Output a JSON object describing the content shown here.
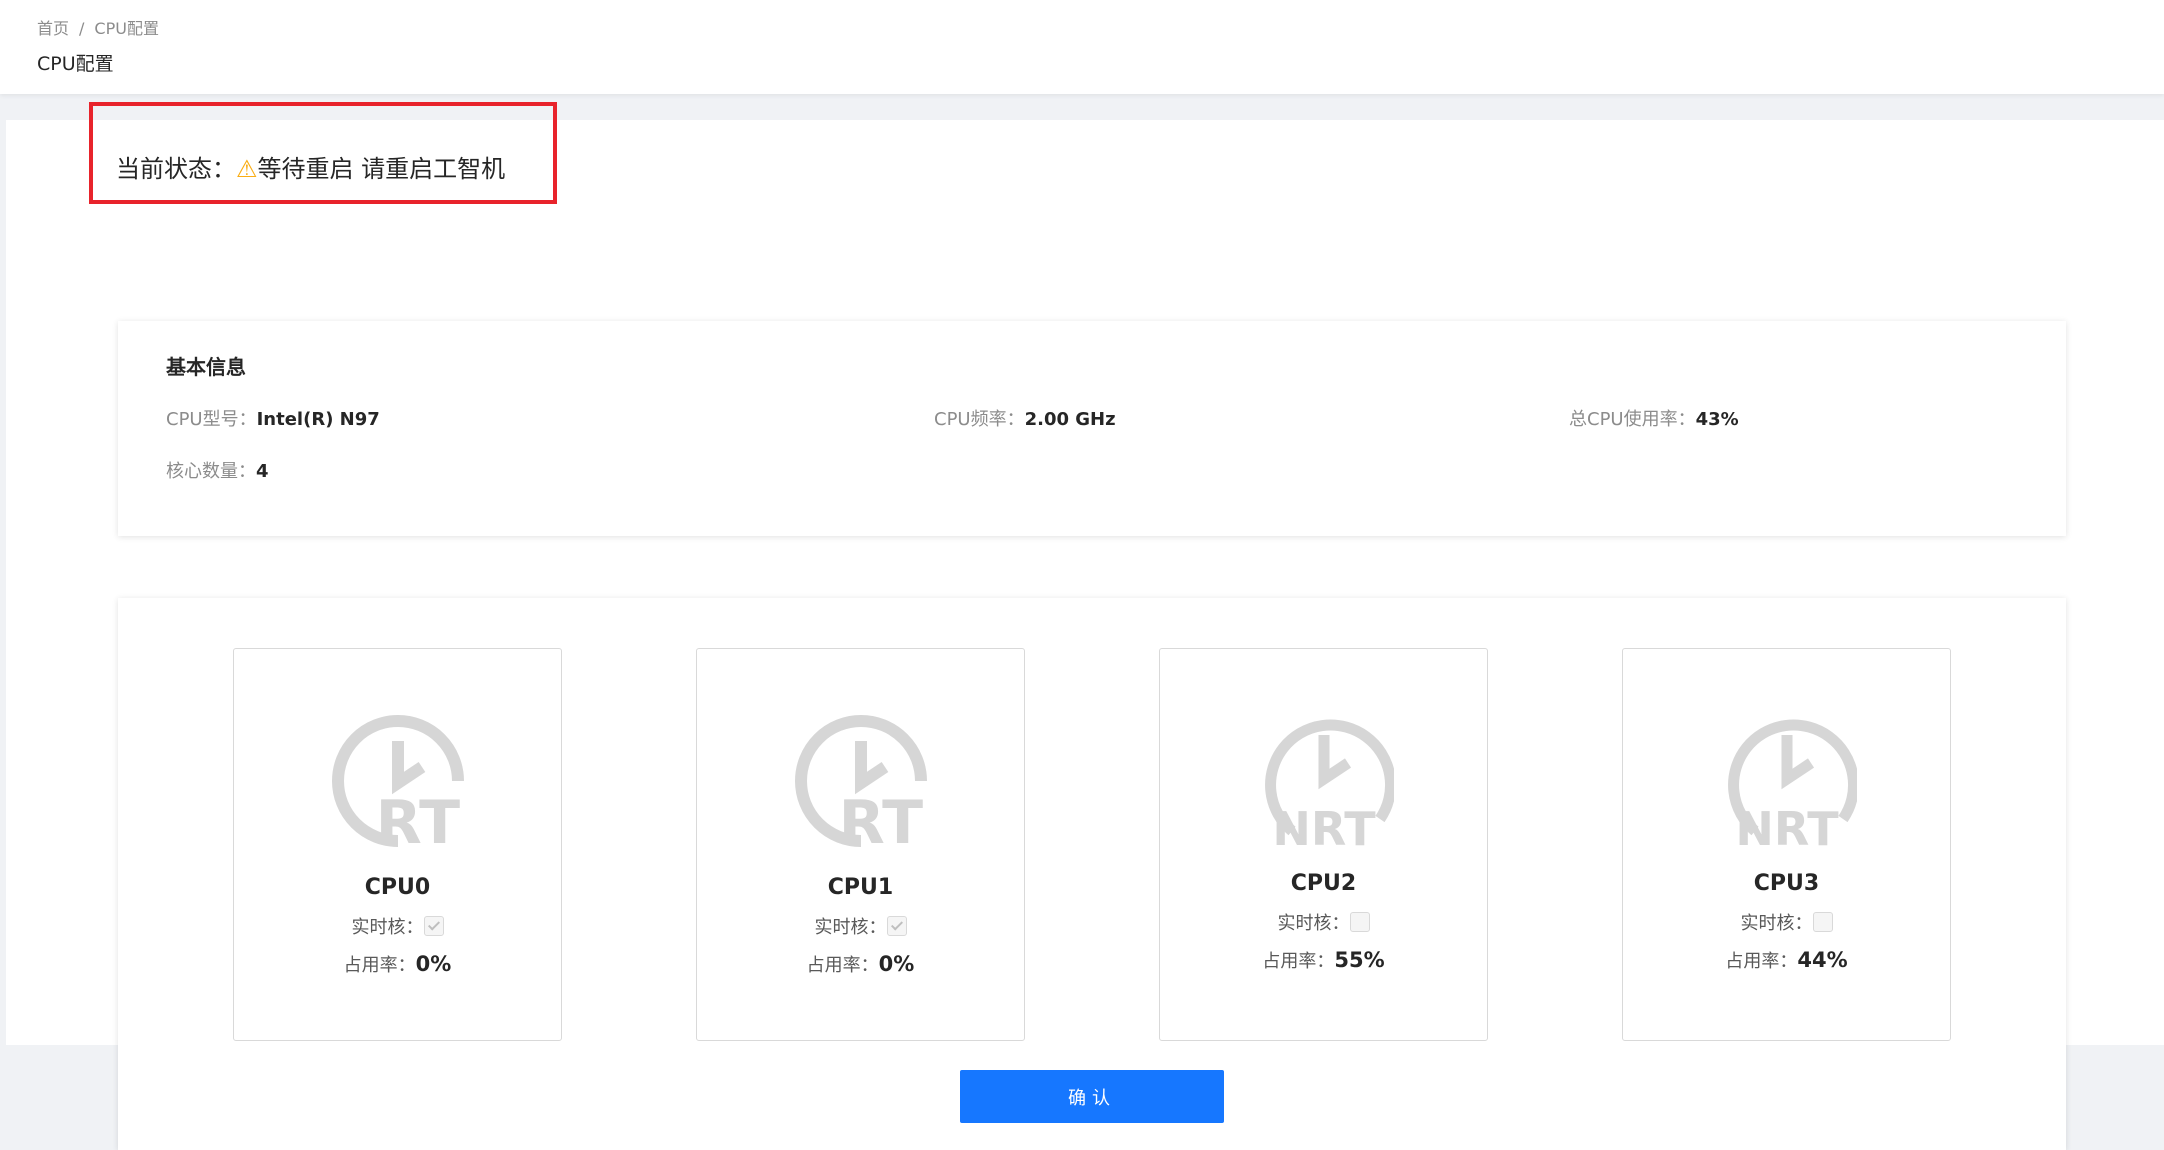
{
  "breadcrumb": {
    "home": "首页",
    "separator": "/",
    "current": "CPU配置"
  },
  "page_title": "CPU配置",
  "status": {
    "label": "当前状态：",
    "icon": "warning-icon",
    "icon_glyph": "⚠",
    "text": "等待重启 请重启工智机",
    "highlight_color": "#e8232b",
    "icon_color": "#faad14"
  },
  "basic_info": {
    "title": "基本信息",
    "cpu_model_label": "CPU型号：",
    "cpu_model": "Intel(R) N97",
    "cpu_freq_label": "CPU频率：",
    "cpu_freq": "2.00 GHz",
    "total_usage_label": "总CPU使用率：",
    "total_usage": "43%",
    "core_count_label": "核心数量：",
    "core_count": "4"
  },
  "cpus": [
    {
      "name": "CPU0",
      "badge": "RT",
      "rt_label": "实时核：",
      "realtime": true,
      "usage_label": "占用率：",
      "usage": "0%"
    },
    {
      "name": "CPU1",
      "badge": "RT",
      "rt_label": "实时核：",
      "realtime": true,
      "usage_label": "占用率：",
      "usage": "0%"
    },
    {
      "name": "CPU2",
      "badge": "NRT",
      "rt_label": "实时核：",
      "realtime": false,
      "usage_label": "占用率：",
      "usage": "55%"
    },
    {
      "name": "CPU3",
      "badge": "NRT",
      "rt_label": "实时核：",
      "realtime": false,
      "usage_label": "占用率：",
      "usage": "44%"
    }
  ],
  "confirm_label": "确认",
  "colors": {
    "primary": "#1677ff",
    "icon_gray": "#d6d6d6"
  }
}
